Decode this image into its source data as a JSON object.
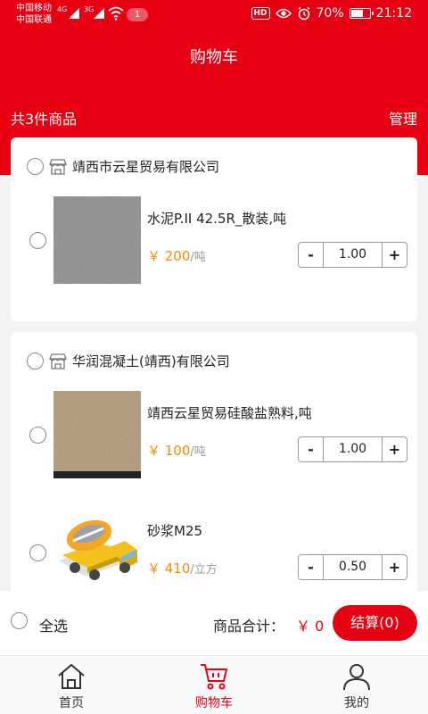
{
  "status_bar": {
    "carrier1": "中国移动",
    "carrier2": "中国联通",
    "net1": "4G",
    "net2": "3G",
    "notification_count": "1",
    "battery": "70%",
    "battery_level": 0.7,
    "time": "21:12"
  },
  "header": {
    "title": "购物车",
    "item_count": "共3件商品",
    "manage": "管理"
  },
  "shops": [
    {
      "name": "靖西市云星贸易有限公司",
      "items": [
        {
          "name": "水泥P.II 42.5R_散装,吨",
          "price": "￥ 200",
          "unit": "/吨",
          "qty": "1.00",
          "image": "cement-photo"
        }
      ]
    },
    {
      "name": "华润混凝土(靖西)有限公司",
      "items": [
        {
          "name": "靖西云星贸易硅酸盐熟料,吨",
          "price": "￥ 100",
          "unit": "/吨",
          "qty": "1.00",
          "image": "clinker-photo"
        },
        {
          "name": "砂浆M25",
          "price": "￥ 410",
          "unit": "/立方",
          "qty": "0.50",
          "image": "mixer-truck-icon"
        }
      ]
    }
  ],
  "checkout": {
    "select_all": "全选",
    "total_label": "商品合计：",
    "total_value": "￥ 0",
    "button": "结算(0)"
  },
  "tabs": [
    {
      "label": "首页",
      "icon": "home-icon",
      "active": false
    },
    {
      "label": "购物车",
      "icon": "cart-icon",
      "active": true
    },
    {
      "label": "我的",
      "icon": "user-icon",
      "active": false
    }
  ],
  "colors": {
    "primary": "#e60012",
    "price": "#ff8a00"
  }
}
